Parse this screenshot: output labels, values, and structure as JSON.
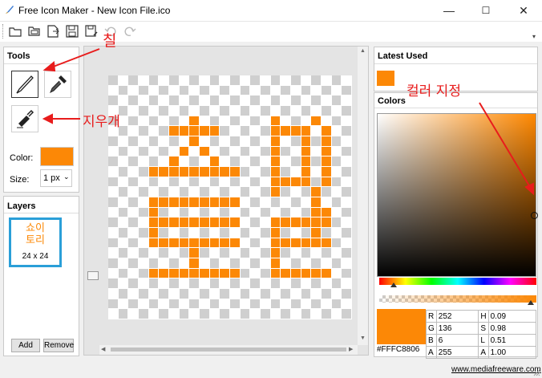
{
  "window": {
    "title": "Free Icon Maker - New Icon File.ico",
    "minimize": "—",
    "maximize": "☐",
    "close": "✕"
  },
  "toolbar": {
    "buttons": [
      "new-folder-icon",
      "open-icon",
      "export-icon",
      "save-icon",
      "save-as-icon",
      "undo-icon",
      "redo-icon"
    ]
  },
  "tools": {
    "header": "Tools",
    "color_label": "Color:",
    "size_label": "Size:",
    "size_value": "1 px",
    "color": "#FC8806"
  },
  "layers": {
    "header": "Layers",
    "thumb_text_line1": "쇼이",
    "thumb_text_line2": "토리",
    "thumb_size": "24 x 24",
    "add": "Add",
    "remove": "Remove"
  },
  "annotations": {
    "brush": "칠",
    "eraser": "지우개",
    "color": "컬러 지정"
  },
  "latest_used": {
    "header": "Latest Used",
    "colors": [
      "#FC8806"
    ]
  },
  "colors": {
    "header": "Colors",
    "hex": "#FFFC8806",
    "R": "252",
    "G": "136",
    "B": "6",
    "A": "255",
    "H": "0.09",
    "S": "0.98",
    "L": "0.51",
    "A2": "1.00"
  },
  "status": {
    "link": "www.mediafreeware.com"
  },
  "canvas": {
    "grid_size": 24,
    "fill_color": "#FC8806",
    "rows": [
      "........................",
      "........................",
      "........................",
      "........................",
      "........#.......#...#...",
      "......#####.....####.#..",
      "........#.......#..#.#..",
      ".......#.#......#..#.#..",
      "......#...#.....#..#.#..",
      "....#########...#..#.#..",
      "................####.#..",
      "................#...#...",
      "....#########.......#...",
      "....#...............##..",
      "....#########...######..",
      "....#...........#...#...",
      "....#########...######..",
      "........#.......#.......",
      "........#.......#.......",
      "....#########...######..",
      "........................",
      "........................",
      "........................",
      "........................"
    ]
  }
}
